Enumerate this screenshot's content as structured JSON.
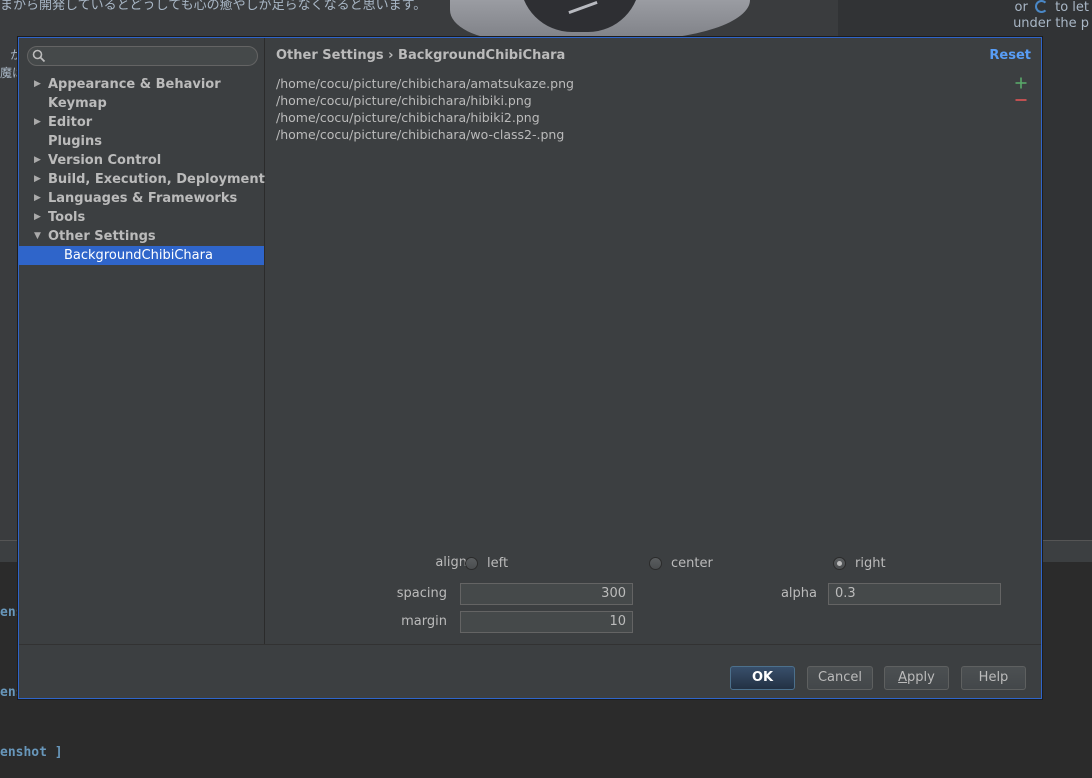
{
  "background": {
    "top_text": "まから開発しているとどうしても心の癒やしが足らなくなると思います。",
    "right_text_line1_before": "or",
    "right_text_line1_after": "to let",
    "right_text_line2": "under the p",
    "left_text_line1": "か",
    "left_text_line2": "魔は",
    "code_line1": "ens",
    "code_line2": "ens",
    "code_line3": "enshot ]"
  },
  "dialog": {
    "search": {
      "placeholder": "",
      "value": ""
    },
    "tree": [
      {
        "label": "Appearance & Behavior",
        "arrow": "▶",
        "selected": false,
        "child": false
      },
      {
        "label": "Keymap",
        "arrow": "",
        "selected": false,
        "child": false
      },
      {
        "label": "Editor",
        "arrow": "▶",
        "selected": false,
        "child": false
      },
      {
        "label": "Plugins",
        "arrow": "",
        "selected": false,
        "child": false
      },
      {
        "label": "Version Control",
        "arrow": "▶",
        "selected": false,
        "child": false
      },
      {
        "label": "Build, Execution, Deployment",
        "arrow": "▶",
        "selected": false,
        "child": false
      },
      {
        "label": "Languages & Frameworks",
        "arrow": "▶",
        "selected": false,
        "child": false
      },
      {
        "label": "Tools",
        "arrow": "▶",
        "selected": false,
        "child": false
      },
      {
        "label": "Other Settings",
        "arrow": "▼",
        "selected": false,
        "child": false
      },
      {
        "label": "BackgroundChibiChara",
        "arrow": "",
        "selected": true,
        "child": true
      }
    ],
    "breadcrumb": "Other Settings › BackgroundChibiChara",
    "reset_label": "Reset",
    "files": [
      "/home/cocu/picture/chibichara/amatsukaze.png",
      "/home/cocu/picture/chibichara/hibiki.png",
      "/home/cocu/picture/chibichara/hibiki2.png",
      "/home/cocu/picture/chibichara/wo-class2-.png"
    ],
    "form": {
      "align_label": "align",
      "align_options": [
        "left",
        "center",
        "right"
      ],
      "align_selected": "right",
      "spacing_label": "spacing",
      "spacing_value": "300",
      "margin_label": "margin",
      "margin_value": "10",
      "alpha_label": "alpha",
      "alpha_value": "0.3"
    },
    "buttons": {
      "ok": "OK",
      "cancel": "Cancel",
      "apply_mnemonic": "A",
      "apply_rest": "pply",
      "help": "Help"
    }
  },
  "colors": {
    "selection": "#2f65ca",
    "link": "#589df6",
    "add": "#59a869",
    "remove": "#e05555"
  },
  "icons": [
    "search-icon",
    "expand-arrow-icon",
    "collapse-arrow-icon",
    "add-icon",
    "remove-icon",
    "sync-icon"
  ]
}
